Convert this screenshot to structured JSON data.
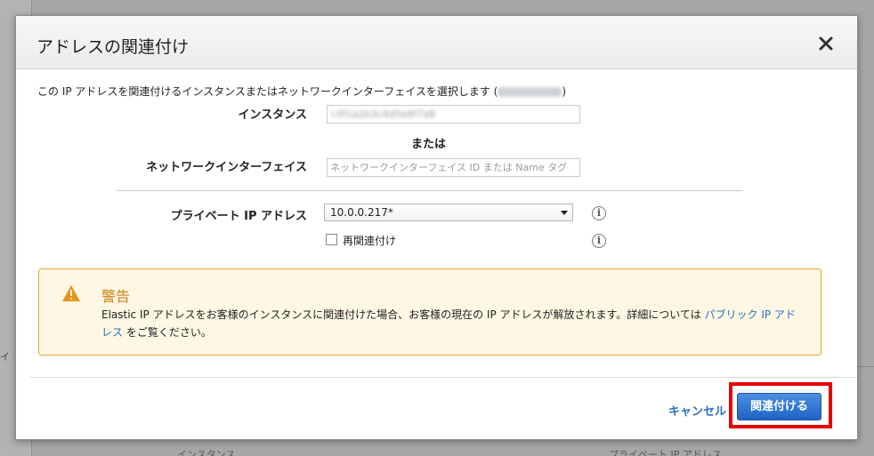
{
  "background": {
    "left_char": "イ",
    "bottom_left_text": "インスタンス",
    "bottom_right_text": "プライベート IP アドレス"
  },
  "modal": {
    "title": "アドレスの関連付け",
    "close_icon": "close-x-icon"
  },
  "form": {
    "intro_prefix": "この IP アドレスを関連付けるインスタンスまたはネットワークインターフェイスを選択します (",
    "intro_suffix": ")",
    "instance_label": "インスタンス",
    "instance_value": "i-0f1a2b3c4d5e6f7a8",
    "or_text": "または",
    "network_interface_label": "ネットワークインターフェイス",
    "network_interface_placeholder": "ネットワークインターフェイス ID または Name タグ",
    "private_ip_label": "プライベート IP アドレス",
    "private_ip_selected": "10.0.0.217*",
    "reassociate_label": "再関連付け",
    "reassociate_checked": false
  },
  "warning": {
    "icon": "warning-triangle-icon",
    "title": "警告",
    "body": "Elastic IP アドレスをお客様のインスタンスに関連付けた場合、お客様の現在の IP アドレスが解放されます。詳細については ",
    "link_text": "パブリック IP アドレス",
    "body_end": " をご覧ください。"
  },
  "footer": {
    "cancel_label": "キャンセル",
    "associate_label": "関連付ける"
  },
  "colors": {
    "primary": "#1f63c6",
    "link": "#2b6fc4",
    "warning_border": "#e3a33a",
    "warning_title": "#d07d12",
    "highlight": "#e60000"
  }
}
